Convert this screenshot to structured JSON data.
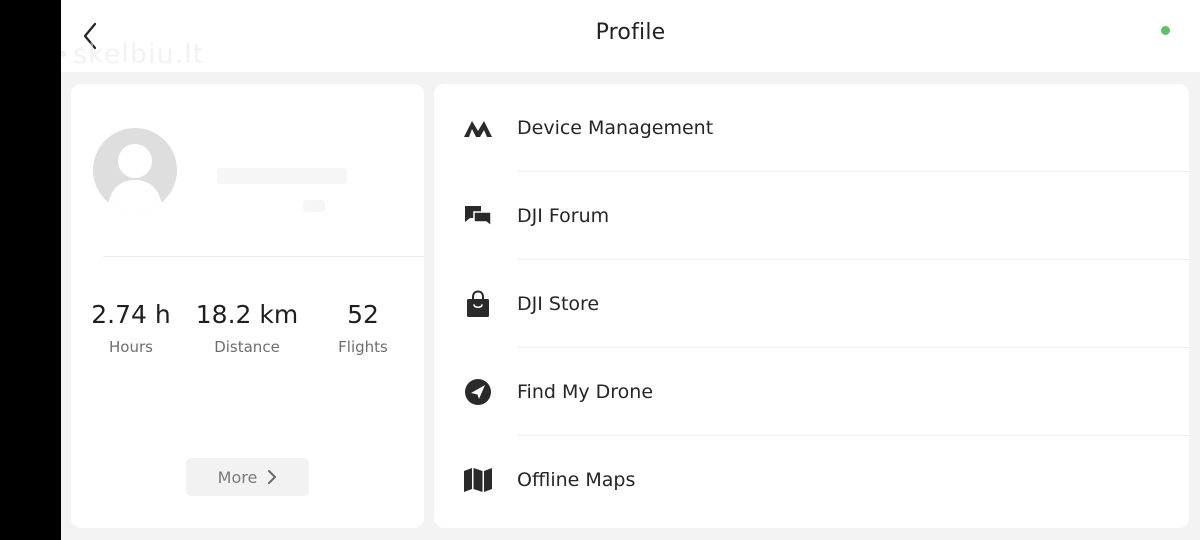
{
  "header": {
    "title": "Profile",
    "back_icon": "chevron-left-icon",
    "status_dot_color": "#5cc16a"
  },
  "watermark": {
    "text": "skelbiu.lt"
  },
  "profile": {
    "stats": [
      {
        "value": "2.74 h",
        "label": "Hours"
      },
      {
        "value": "18.2 km",
        "label": "Distance"
      },
      {
        "value": "52",
        "label": "Flights"
      }
    ],
    "more_label": "More"
  },
  "menu": {
    "items": [
      {
        "label": "Device Management",
        "icon": "device-management-icon"
      },
      {
        "label": "DJI Forum",
        "icon": "forum-chat-icon"
      },
      {
        "label": "DJI Store",
        "icon": "shopping-bag-icon"
      },
      {
        "label": "Find My Drone",
        "icon": "compass-icon"
      },
      {
        "label": "Offline Maps",
        "icon": "folded-map-icon"
      }
    ]
  }
}
